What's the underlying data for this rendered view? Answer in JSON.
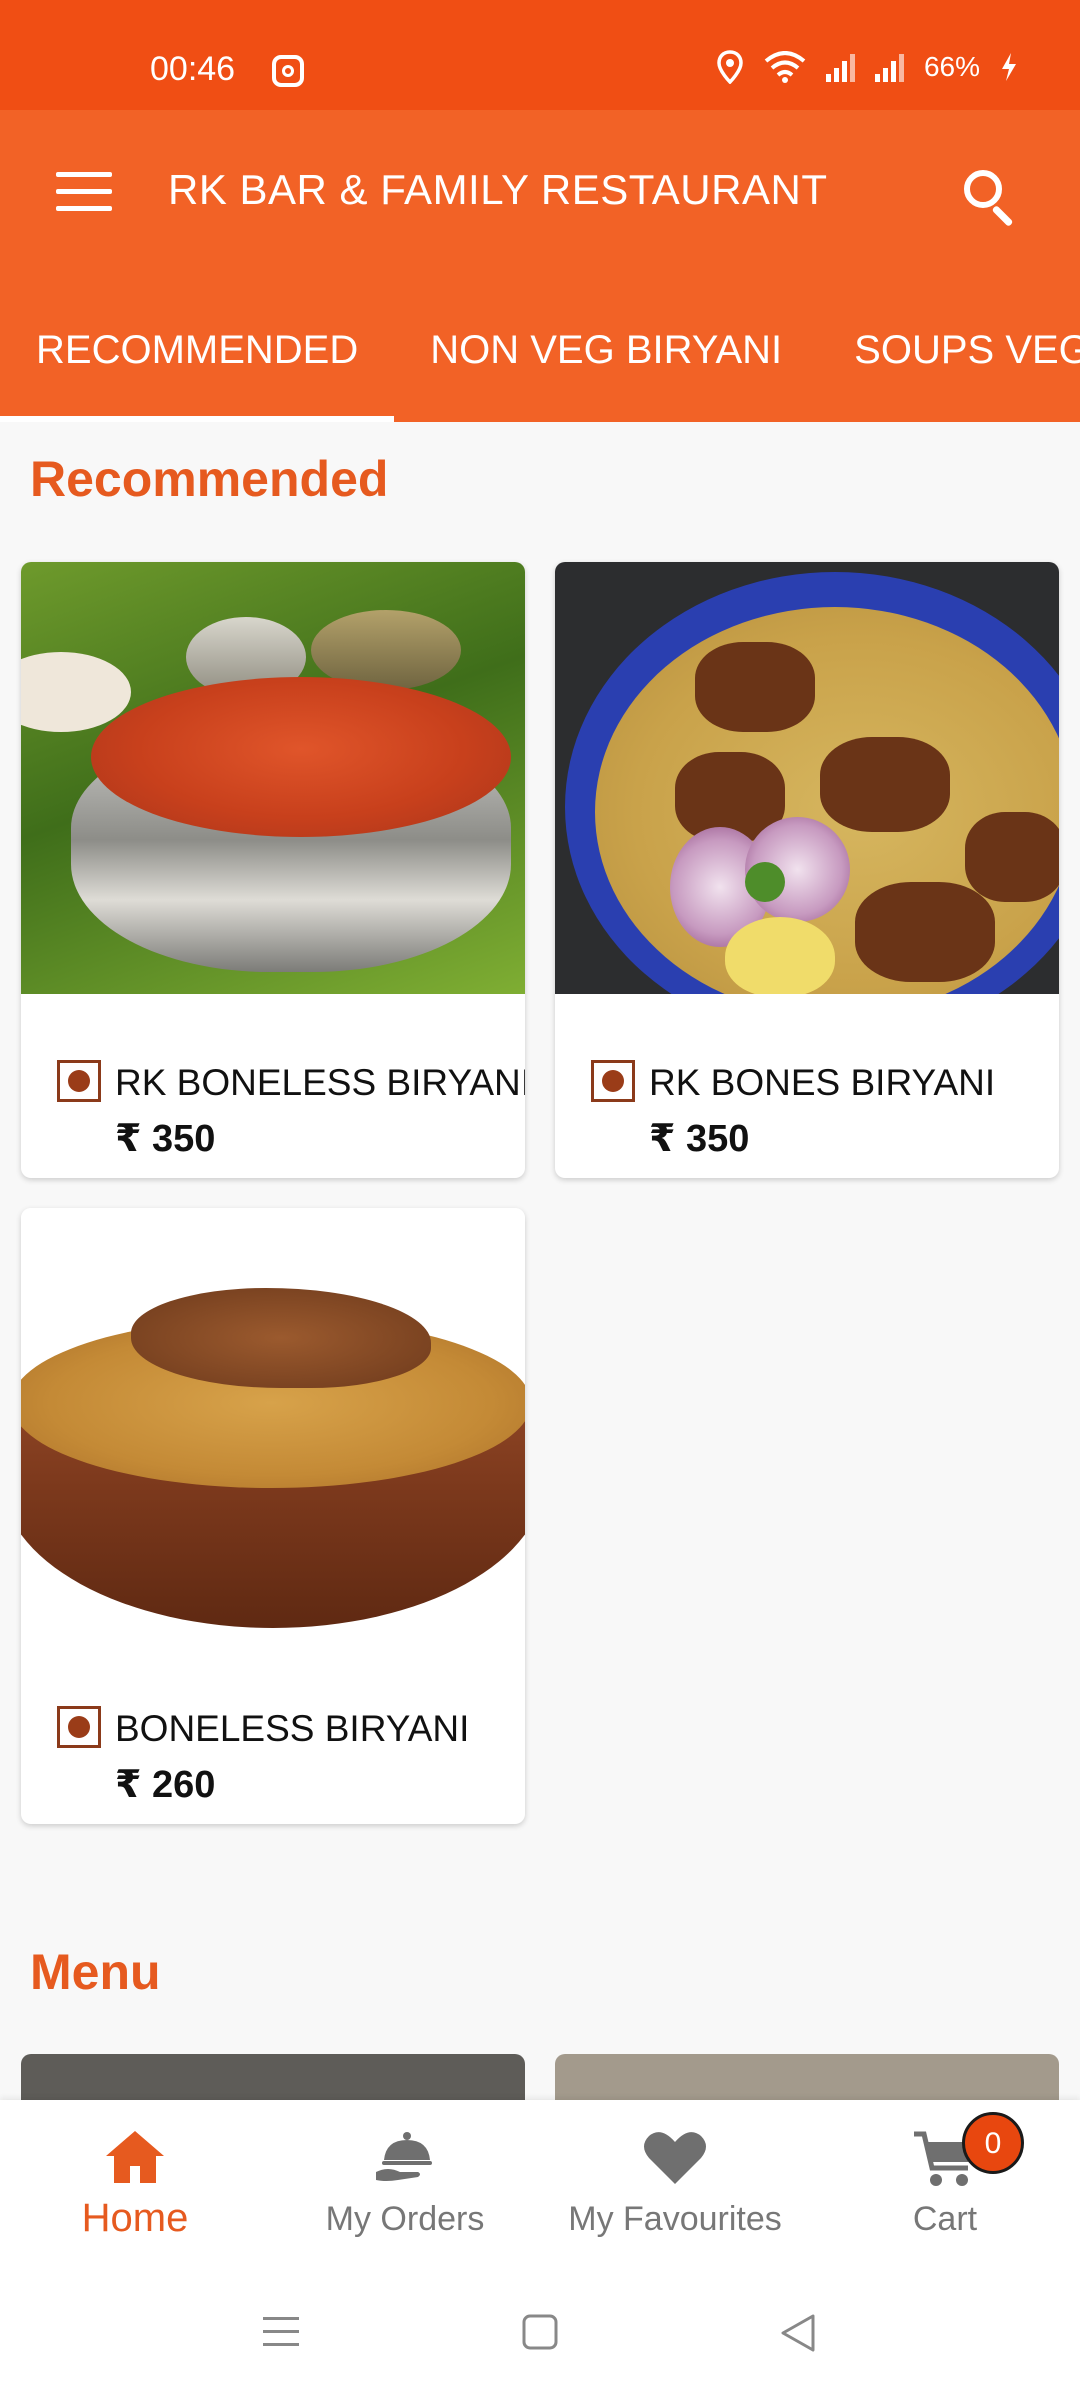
{
  "status_bar": {
    "time": "00:46",
    "battery": "66%"
  },
  "app_bar": {
    "title": "RK BAR & FAMILY RESTAURANT"
  },
  "tabs": [
    {
      "label": "RECOMMENDED",
      "active": true
    },
    {
      "label": "NON VEG BIRYANI",
      "active": false
    },
    {
      "label": "SOUPS VEG",
      "active": false
    }
  ],
  "sections": {
    "recommended": "Recommended",
    "menu": "Menu"
  },
  "items": [
    {
      "name": "RK BONELESS BIRYANI",
      "price": "₹ 350"
    },
    {
      "name": "RK BONES BIRYANI",
      "price": "₹ 350"
    },
    {
      "name": "BONELESS BIRYANI",
      "price": "₹ 260"
    }
  ],
  "bottom_nav": [
    {
      "label": "Home",
      "icon": "home-icon",
      "active": true
    },
    {
      "label": "My Orders",
      "icon": "cloche-icon",
      "active": false
    },
    {
      "label": "My Favourites",
      "icon": "heart-icon",
      "active": false
    },
    {
      "label": "Cart",
      "icon": "cart-icon",
      "active": false,
      "badge": "0"
    }
  ],
  "colors": {
    "primary": "#f26226",
    "statusbar": "#f04e14",
    "accent_text": "#e65a1f"
  }
}
